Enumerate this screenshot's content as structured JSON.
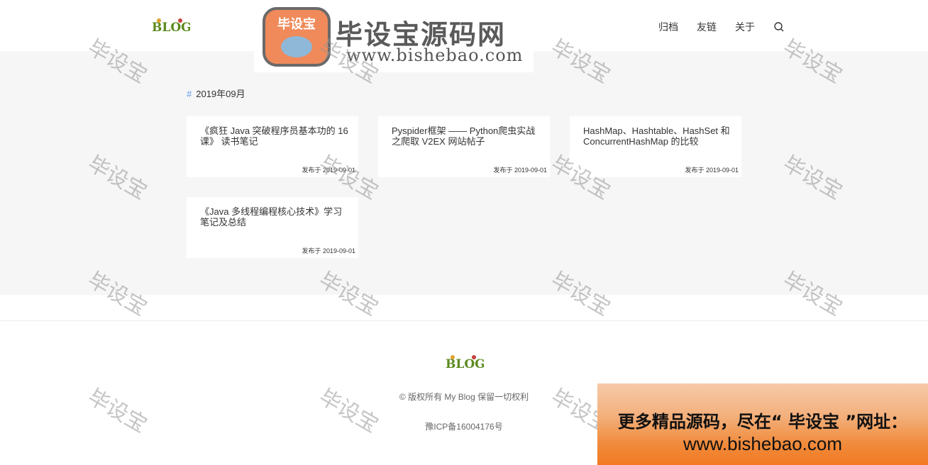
{
  "header": {
    "logo_text": "BLOG",
    "nav": [
      "归档",
      "友链",
      "关于"
    ],
    "search_icon": "search-icon"
  },
  "banner": {
    "badge_text": "毕设宝",
    "title": "毕设宝源码网",
    "url": "www.bishebao.com"
  },
  "archive": {
    "hash": "#",
    "month": "2019年09月",
    "posts": [
      {
        "title": "《疯狂 Java 突破程序员基本功的 16 课》 读书笔记",
        "date": "发布于 2019-09-01"
      },
      {
        "title": "Pyspider框架 —— Python爬虫实战之爬取 V2EX 网站帖子",
        "date": "发布于 2019-09-01"
      },
      {
        "title": "HashMap、Hashtable、HashSet 和 ConcurrentHashMap 的比较",
        "date": "发布于 2019-09-01"
      },
      {
        "title": "《Java 多线程编程核心技术》学习笔记及总结",
        "date": "发布于 2019-09-01"
      }
    ]
  },
  "footer": {
    "logo_text": "BLOG",
    "copyright": "© 版权所有 My Blog 保留一切权利",
    "icp": "豫ICP备16004176号"
  },
  "watermark": "毕设宝",
  "promo": {
    "line1": "更多精品源码，尽在“ 毕设宝 ”网址：",
    "line2": "www.bishebao.com"
  },
  "colors": {
    "accent": "#5f9be8",
    "main_bg": "#f6f6f6",
    "badge": "#f08a5a"
  }
}
